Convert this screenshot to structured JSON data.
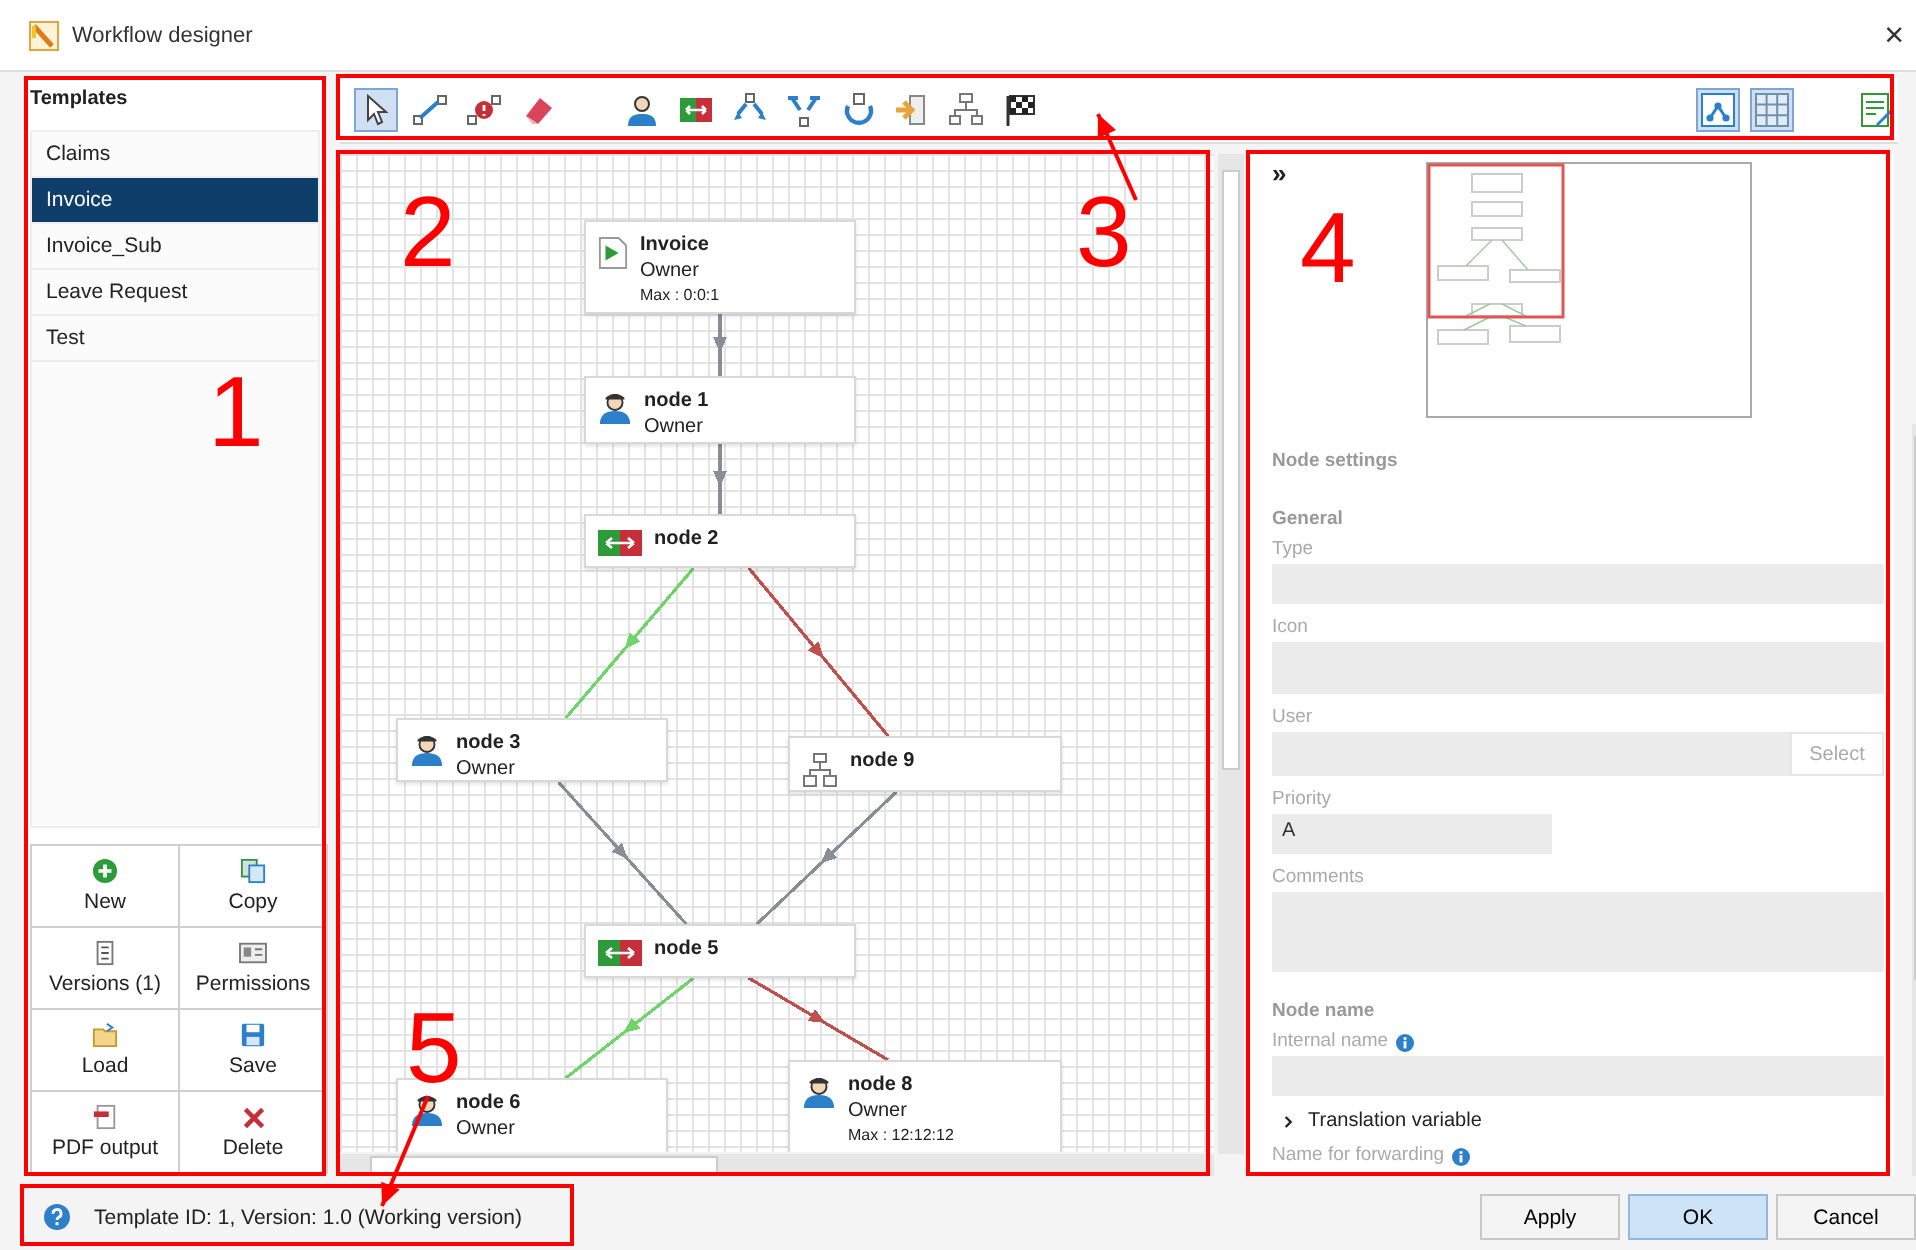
{
  "window": {
    "title": "Workflow designer",
    "close": "×"
  },
  "templates": {
    "heading": "Templates",
    "items": [
      {
        "label": "Claims",
        "selected": false
      },
      {
        "label": "Invoice",
        "selected": true
      },
      {
        "label": "Invoice_Sub",
        "selected": false
      },
      {
        "label": "Leave Request",
        "selected": false
      },
      {
        "label": "Test",
        "selected": false
      }
    ],
    "actions": [
      {
        "kind": "new",
        "label": "New"
      },
      {
        "kind": "copy",
        "label": "Copy"
      },
      {
        "kind": "versions",
        "label": "Versions (1)"
      },
      {
        "kind": "permissions",
        "label": "Permissions"
      },
      {
        "kind": "load",
        "label": "Load"
      },
      {
        "kind": "save",
        "label": "Save"
      },
      {
        "kind": "pdf",
        "label": "PDF output"
      },
      {
        "kind": "delete",
        "label": "Delete"
      }
    ]
  },
  "toolbar": {
    "left": [
      {
        "kind": "pointer",
        "selected": true
      },
      {
        "kind": "connect",
        "selected": false
      },
      {
        "kind": "connect-error",
        "selected": false
      },
      {
        "kind": "eraser",
        "selected": false
      },
      {
        "kind": "user",
        "selected": false
      },
      {
        "kind": "switch",
        "selected": false
      },
      {
        "kind": "split",
        "selected": false
      },
      {
        "kind": "merge",
        "selected": false
      },
      {
        "kind": "loop",
        "selected": false
      },
      {
        "kind": "exit",
        "selected": false
      },
      {
        "kind": "subflow",
        "selected": false
      },
      {
        "kind": "flag",
        "selected": false
      }
    ],
    "right": [
      {
        "kind": "layout",
        "selected": true
      },
      {
        "kind": "grid",
        "selected": true
      },
      {
        "kind": "edit",
        "selected": false
      }
    ]
  },
  "canvas": {
    "nodes": [
      {
        "kind": "start",
        "title": "Invoice",
        "subtitle": "Owner",
        "max": "Max : 0:0:1"
      },
      {
        "kind": "user",
        "title": "node 1",
        "subtitle": "Owner"
      },
      {
        "kind": "switch",
        "title": "node 2"
      },
      {
        "kind": "user",
        "title": "node 3",
        "subtitle": "Owner"
      },
      {
        "kind": "subflow",
        "title": "node 9"
      },
      {
        "kind": "switch",
        "title": "node 5"
      },
      {
        "kind": "user",
        "title": "node 6",
        "subtitle": "Owner"
      },
      {
        "kind": "user",
        "title": "node 8",
        "subtitle": "Owner",
        "max": "Max : 12:12:12"
      }
    ],
    "edges": [
      {
        "color": "#8a8d96"
      },
      {
        "color": "#8a8d96"
      },
      {
        "color": "#6fd46a"
      },
      {
        "color": "#c0504d"
      },
      {
        "color": "#8a8d96"
      },
      {
        "color": "#8a8d96"
      },
      {
        "color": "#6fd46a"
      },
      {
        "color": "#c0504d"
      }
    ]
  },
  "properties": {
    "expand": "»",
    "heading": "Node settings",
    "groups": [
      {
        "heading": "General",
        "fields": [
          {
            "kind": "text",
            "label": "Type"
          },
          {
            "kind": "icon",
            "label": "Icon"
          },
          {
            "kind": "picker",
            "label": "User",
            "button": "Select"
          },
          {
            "kind": "short",
            "label": "Priority",
            "value": "A"
          },
          {
            "kind": "textarea",
            "label": "Comments"
          }
        ]
      },
      {
        "heading": "Node name",
        "fields": [
          {
            "kind": "text",
            "label": "Internal name",
            "info": true
          },
          {
            "kind": "expander",
            "label": "Translation variable",
            "expanded": false
          },
          {
            "kind": "label",
            "label": "Name for forwarding",
            "info": true
          }
        ]
      }
    ]
  },
  "status_bar": {
    "text": "Template ID: 1, Version: 1.0 (Working version)",
    "buttons": [
      {
        "label": "Apply",
        "primary": false
      },
      {
        "label": "OK",
        "primary": true
      },
      {
        "label": "Cancel",
        "primary": false
      }
    ]
  },
  "annotations": [
    {
      "label": "1"
    },
    {
      "label": "2"
    },
    {
      "label": "3"
    },
    {
      "label": "4"
    },
    {
      "label": "5"
    }
  ]
}
